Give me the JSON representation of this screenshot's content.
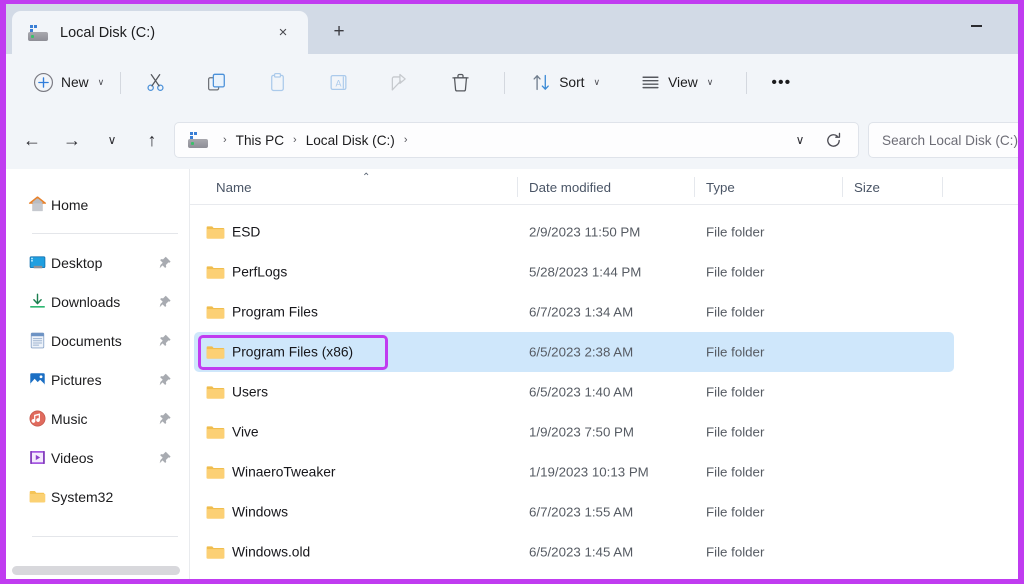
{
  "window": {
    "accent_annotation_color": "#c03cf0",
    "titlebar_color": "#d2dae6",
    "selection_color": "#cfe7fb",
    "minimize_label": "Minimize"
  },
  "tab": {
    "title": "Local Disk (C:)",
    "icon": "drive-icon",
    "close_label": "×",
    "new_tab_label": "+"
  },
  "toolbar": {
    "new_label": "New",
    "cut_label": "Cut",
    "copy_label": "Copy",
    "paste_label": "Paste",
    "rename_label": "Rename",
    "share_label": "Share",
    "delete_label": "Delete",
    "sort_label": "Sort",
    "view_label": "View",
    "more_label": "•••",
    "chevron": "∨"
  },
  "addressbar": {
    "back_label": "←",
    "forward_label": "→",
    "recent_label": "∨",
    "up_label": "↑",
    "dropdown_label": "∨",
    "refresh_label": "Refresh",
    "crumbs": [
      {
        "label": "This PC"
      },
      {
        "label": "Local Disk (C:)"
      }
    ],
    "separator": "›"
  },
  "search": {
    "placeholder": "Search Local Disk (C:)"
  },
  "sidebar": {
    "home": {
      "label": "Home",
      "icon": "home-icon"
    },
    "items": [
      {
        "label": "Desktop",
        "icon": "desktop-icon",
        "pinned": true
      },
      {
        "label": "Downloads",
        "icon": "download-icon",
        "pinned": true
      },
      {
        "label": "Documents",
        "icon": "documents-icon",
        "pinned": true
      },
      {
        "label": "Pictures",
        "icon": "pictures-icon",
        "pinned": true
      },
      {
        "label": "Music",
        "icon": "music-icon",
        "pinned": true
      },
      {
        "label": "Videos",
        "icon": "videos-icon",
        "pinned": true
      },
      {
        "label": "System32",
        "icon": "folder-icon",
        "pinned": false
      }
    ]
  },
  "filelist": {
    "columns": [
      {
        "label": "Name"
      },
      {
        "label": "Date modified"
      },
      {
        "label": "Type"
      },
      {
        "label": "Size"
      }
    ],
    "sort_column": "Name",
    "sort_direction": "ascending",
    "sort_caret": "⌃",
    "rows": [
      {
        "name": "ESD",
        "date": "2/9/2023 11:50 PM",
        "type": "File folder",
        "size": "",
        "selected": false
      },
      {
        "name": "PerfLogs",
        "date": "5/28/2023 1:44 PM",
        "type": "File folder",
        "size": "",
        "selected": false
      },
      {
        "name": "Program Files",
        "date": "6/7/2023 1:34 AM",
        "type": "File folder",
        "size": "",
        "selected": false
      },
      {
        "name": "Program Files (x86)",
        "date": "6/5/2023 2:38 AM",
        "type": "File folder",
        "size": "",
        "selected": true
      },
      {
        "name": "Users",
        "date": "6/5/2023 1:40 AM",
        "type": "File folder",
        "size": "",
        "selected": false
      },
      {
        "name": "Vive",
        "date": "1/9/2023 7:50 PM",
        "type": "File folder",
        "size": "",
        "selected": false
      },
      {
        "name": "WinaeroTweaker",
        "date": "1/19/2023 10:13 PM",
        "type": "File folder",
        "size": "",
        "selected": false
      },
      {
        "name": "Windows",
        "date": "6/7/2023 1:55 AM",
        "type": "File folder",
        "size": "",
        "selected": false
      },
      {
        "name": "Windows.old",
        "date": "6/5/2023 1:45 AM",
        "type": "File folder",
        "size": "",
        "selected": false
      }
    ]
  }
}
